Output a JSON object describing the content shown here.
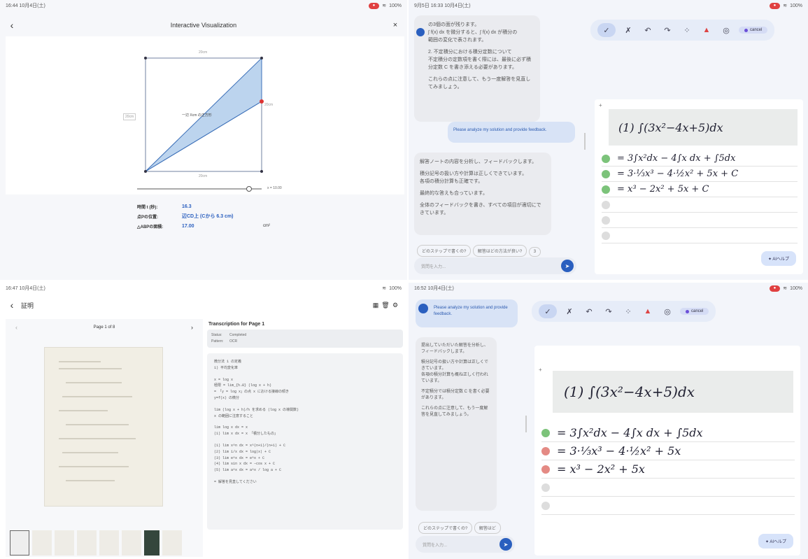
{
  "colors": {
    "accent": "#2a5fbf",
    "green": "#7cc37a",
    "red": "#e48a84",
    "shade": "#bcd4ee"
  },
  "q1": {
    "status": {
      "left": "16:44 10月4日(土)",
      "battery": "100%"
    },
    "title": "Interactive Visualization",
    "axis_top": "20cm",
    "axis_bottom": "20cm",
    "side_left": "20cm",
    "side_right": "20cm",
    "inner_label": "一辺 Xcm の正方形",
    "slider_value": "x = 10.00",
    "rows": [
      {
        "label": "時間 t (秒):",
        "value": "16.3",
        "unit": ""
      },
      {
        "label": "点Pの位置:",
        "value": "辺CD上 (Cから 6.3 cm)",
        "unit": ""
      },
      {
        "label": "△ABPの面積:",
        "value": "17.00",
        "unit": "cm²"
      }
    ]
  },
  "q2": {
    "status": {
      "left": "9月5日 16:33 10月4日(土)",
      "battery": "100%"
    },
    "ai1_lines": [
      "の3個の面が残ります。",
      "∫ f(x) dx を微分すると、∫ f(x) dx が積分の",
      "範囲の変化で表されます。",
      "",
      "2. 不定積分における積分定数について",
      "不定積分の定数項を書く際には、最後に必ず積分定数 C を書き添える必要があります。",
      "",
      "これらの点に注意して、もう一度解答を見直してみましょう。"
    ],
    "user_msg": "Please analyze my solution and provide feedback.",
    "ai2_lines": [
      "解答ノートの内容を分析し、フィードバックします。",
      "",
      "積分記号の扱い方や計算は正しくできています。",
      "各項の積分計算も正確です。",
      "",
      "最終的な答えも合っています。",
      "",
      "全体のフィードバックを書き、すべての項目が適切にできています。"
    ],
    "chips": [
      "どのステップで書くの?",
      "解答はどの方法が良い?",
      "3"
    ],
    "input_placeholder": "質問を入力...",
    "toolbar_pill": "cancel",
    "lines": [
      "(1) ∫(3x²−4x+5)dx",
      "= 3∫x²dx − 4∫x dx + ∫5dx",
      "= 3·⅓x³ − 4·½x² + 5x + C",
      "= x³ − 2x² + 5x + C"
    ],
    "fab": "AIヘルプ"
  },
  "q3": {
    "status": {
      "left": "16:47 10月4日(土)",
      "battery": "100%"
    },
    "title": "証明",
    "page_label": "Page 1 of 8",
    "trans_title": "Transcription for Page 1",
    "meta": [
      {
        "k": "Status:",
        "v": "Completed"
      },
      {
        "k": "Pattern:",
        "v": "OCR"
      }
    ],
    "lines": [
      "微分法 1 の定義",
      "1) 平均変化率",
      "",
      "x = log x",
      "極限 = lim_{h→0} (log x + h)",
      "= 「y = log x」の点 x における接線の傾き",
      "y=f(x) の微分",
      "",
      "lim (log x + h)/h を求める (log x の導関数)",
      "x の範囲に注意すること",
      "",
      "lim log x dx = x",
      "(1) lim x dx = x 「積分したもの」",
      "",
      "(1) lim x^n dx = x^(n+1)/(n+1) + C",
      "(2) lim 1/x dx = log|x| + C",
      "(3) lim e^x dx = e^x + C",
      "(4) lim sin x dx = −cos x + C",
      "(5) lim a^x dx = a^x / log a + C",
      "",
      "= 解答を見直してください"
    ]
  },
  "q4": {
    "status": {
      "left": "16:52 10月4日(土)",
      "battery": "100%"
    },
    "user_msg": "Please analyze my solution and provide feedback.",
    "ai_lines": [
      "提出していただいた解答を分析し、フィードバックします。",
      "",
      "積分記号の扱い方や計算は正しくできています。",
      "各項の積分計算も概ね正しく行われています。",
      "",
      "不定積分では積分定数 C を書く必要があります。",
      "",
      "これらの点に注意して、もう一度解答を見直してみましょう。"
    ],
    "chips": [
      "どのステップで書くの?",
      "解答はど"
    ],
    "input_placeholder": "質問を入力...",
    "toolbar_pill": "cancel",
    "lines": [
      "(1) ∫(3x²−4x+5)dx",
      "= 3∫x²dx − 4∫x dx + ∫5dx",
      "= 3·⅓x³ − 4·½x² + 5x",
      "= x³ − 2x² + 5x"
    ],
    "fab": "AIヘルプ"
  }
}
